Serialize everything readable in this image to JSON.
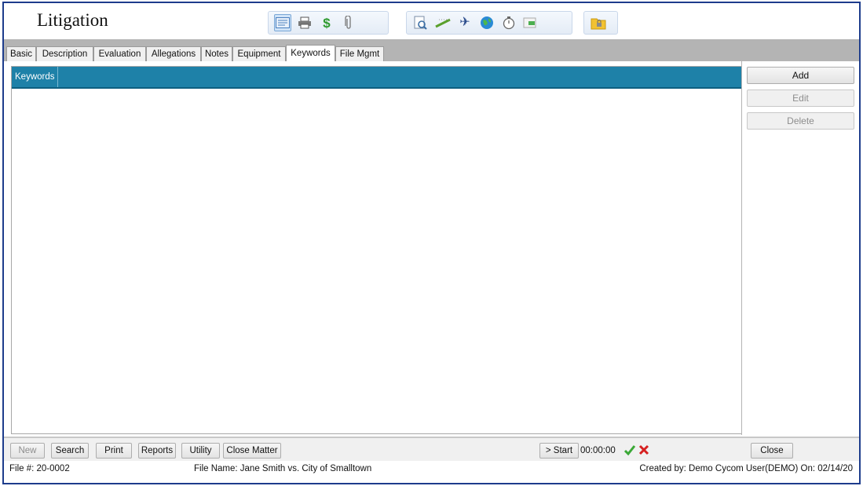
{
  "window": {
    "title": "Litigation"
  },
  "toolbar": {
    "group1": [
      {
        "name": "form-view-icon",
        "glyph": "▤",
        "color": "#4a7fbf",
        "active": true
      },
      {
        "name": "printer-icon",
        "glyph": "🖶",
        "color": "#555555",
        "active": false
      },
      {
        "name": "dollar-icon",
        "glyph": "$",
        "color": "#2e9a2e",
        "active": false
      },
      {
        "name": "paperclip-icon",
        "glyph": "⌇",
        "color": "#777777",
        "active": false
      }
    ],
    "group2": [
      {
        "name": "document-search-icon",
        "glyph": "🔍",
        "color": "#3a6ea5"
      },
      {
        "name": "ruler-icon",
        "glyph": "✎",
        "color": "#5aa02c"
      },
      {
        "name": "airplane-icon",
        "glyph": "✈",
        "color": "#2b4c8c"
      },
      {
        "name": "globe-icon",
        "glyph": "●",
        "color": "#2a8ad4"
      },
      {
        "name": "stopwatch-icon",
        "glyph": "◷",
        "color": "#666666"
      },
      {
        "name": "export-icon",
        "glyph": "➔",
        "color": "#4caf50"
      }
    ],
    "group3": [
      {
        "name": "folder-lock-icon",
        "glyph": "▰",
        "color": "#e2b21f"
      }
    ]
  },
  "tabs": [
    "Basic",
    "Description",
    "Evaluation",
    "Allegations",
    "Notes",
    "Equipment",
    "Keywords",
    "File Mgmt"
  ],
  "active_tab": "Keywords",
  "grid": {
    "columns": [
      "Keywords"
    ],
    "rows": []
  },
  "side_buttons": {
    "add": "Add",
    "edit": "Edit",
    "delete": "Delete"
  },
  "bottom_buttons": {
    "new": "New",
    "search": "Search",
    "print": "Print",
    "reports": "Reports",
    "utility": "Utility",
    "close_matter": "Close Matter",
    "start": "> Start",
    "close": "Close"
  },
  "timer": "00:00:00",
  "status": {
    "file_number": "File #: 20-0002",
    "file_name": "File Name: Jane Smith vs. City of Smalltown",
    "created_by": "Created by: Demo Cycom User(DEMO) On: 02/14/20"
  },
  "colors": {
    "header_blue": "#1e81a8",
    "border_navy": "#1d3c8c",
    "check_green": "#3aa836",
    "cancel_red": "#d62020"
  }
}
